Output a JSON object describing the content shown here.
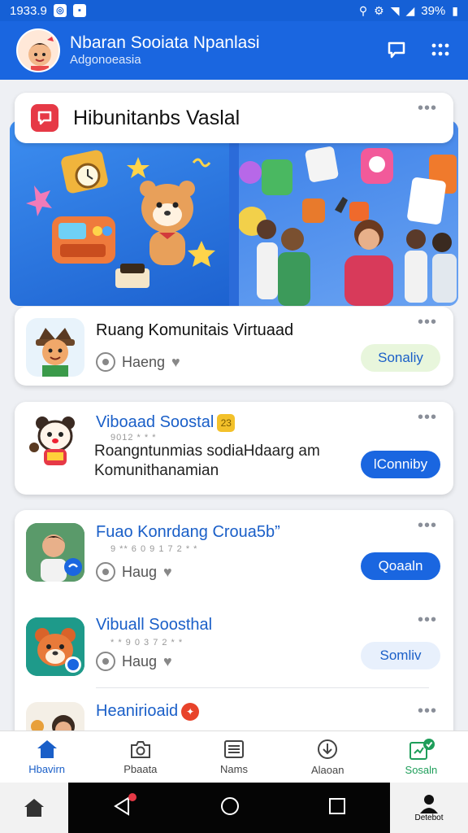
{
  "status_bar": {
    "time": "1933.9",
    "battery": "39%"
  },
  "app_bar": {
    "title": "Nbaran Sooiata Npanlasi",
    "subtitle": "Adgonoeasia"
  },
  "feature": {
    "title": "Hibunitanbs Vaslal"
  },
  "apps": [
    {
      "name": "Ruang Komunitais Virtuaad",
      "meta": "Haeng",
      "button": "Sonaliy"
    },
    {
      "name": "Viboaad Soostal",
      "rating": "9012 * * *",
      "desc_line1": "Roangntunmias sodiaHdaarg am",
      "desc_line2": "Komunithanamian",
      "button": "lConniby",
      "badge": "23"
    },
    {
      "name": "Fuao Konrdang Croua5b”",
      "rating": "9 ** 6 0 9 1 7 2 * *",
      "meta": "Haug",
      "button": "Qoaaln"
    },
    {
      "name": "Vibuall Soosthal",
      "rating": "* * 9 0 3 7 2 * *",
      "meta": "Haug",
      "button": "Somliv"
    },
    {
      "name": "Heanirioaid"
    }
  ],
  "bottom_nav": [
    {
      "label": "Hbavirn"
    },
    {
      "label": "Pbaata"
    },
    {
      "label": "Nams"
    },
    {
      "label": "Alaoan"
    },
    {
      "label": "Sosaln"
    }
  ],
  "system_nav": {
    "right_label": "Detebot"
  },
  "colors": {
    "primary": "#1a66e0",
    "accent_red": "#e63946",
    "accent_green": "#1e9e5a"
  }
}
